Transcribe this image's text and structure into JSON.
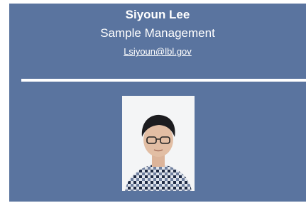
{
  "profile": {
    "name": "Siyoun Lee",
    "role": "Sample Management",
    "email": "Lsiyoun@lbl.gov"
  },
  "colors": {
    "card_background": "#5a749f",
    "text": "#ffffff",
    "divider": "#ffffff"
  },
  "photo": {
    "icon": "person-portrait"
  }
}
